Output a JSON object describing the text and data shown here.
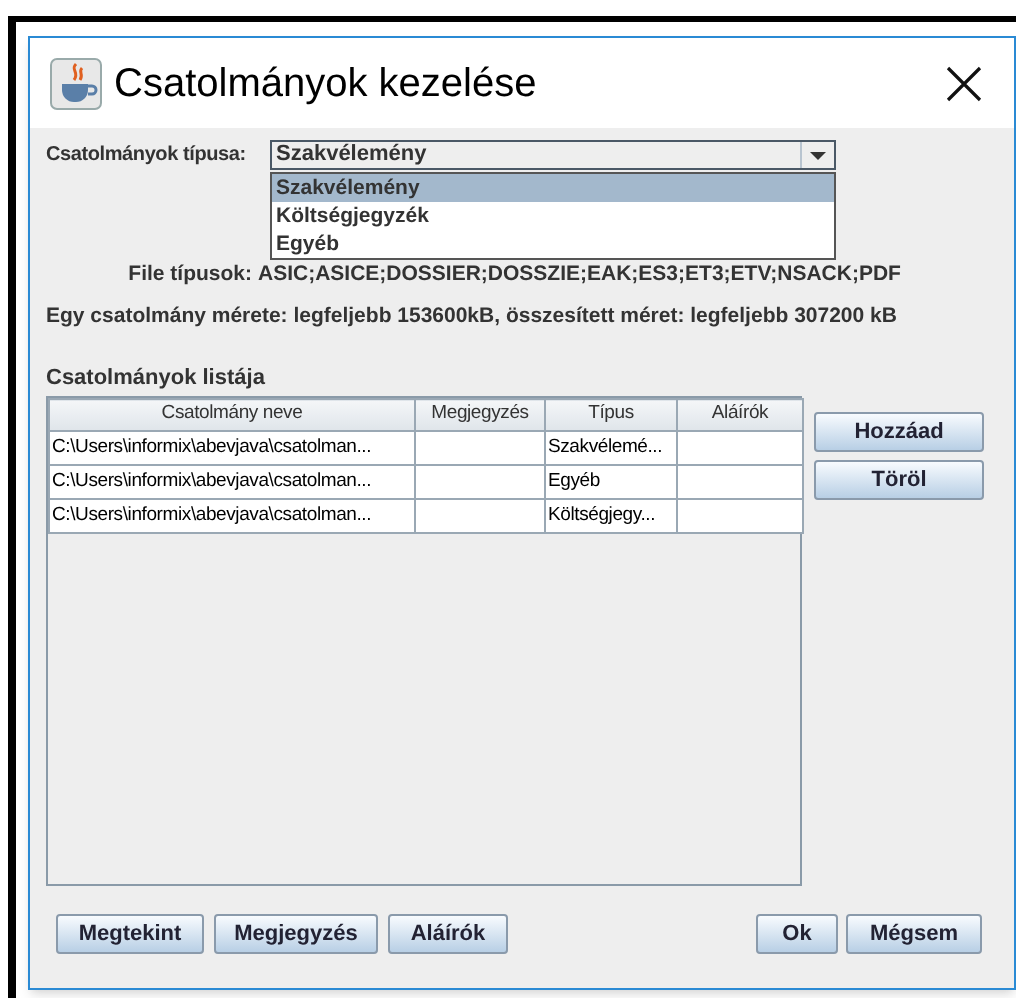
{
  "window": {
    "title": "Csatolmányok kezelése"
  },
  "type_field": {
    "label": "Csatolmányok típusa:",
    "value": "Szakvélemény",
    "expanded": true,
    "options": [
      {
        "label": "Szakvélemény",
        "selected": true
      },
      {
        "label": "Költségjegyzék",
        "selected": false
      },
      {
        "label": "Egyéb",
        "selected": false
      }
    ]
  },
  "file_types": {
    "label": "File típusok:",
    "value": "ASIC;ASICE;DOSSIER;DOSSZIE;EAK;ES3;ET3;ETV;NSACK;PDF"
  },
  "size_info": "Egy csatolmány mérete: legfeljebb 153600kB, összesített méret: legfeljebb 307200 kB",
  "list_title": "Csatolmányok listája",
  "table": {
    "columns": [
      "Csatolmány neve",
      "Megjegyzés",
      "Típus",
      "Aláírók"
    ],
    "rows": [
      [
        "C:\\Users\\informix\\abevjava\\csatolman...",
        "",
        "Szakvélemé...",
        ""
      ],
      [
        "C:\\Users\\informix\\abevjava\\csatolman...",
        "",
        "Egyéb",
        ""
      ],
      [
        "C:\\Users\\informix\\abevjava\\csatolman...",
        "",
        "Költségjegy...",
        ""
      ]
    ]
  },
  "side_buttons": [
    "Hozzáad",
    "Töröl"
  ],
  "bottom_left_buttons": [
    "Megtekint",
    "Megjegyzés",
    "Aláírók"
  ],
  "bottom_right_buttons": [
    "Ok",
    "Mégsem"
  ]
}
